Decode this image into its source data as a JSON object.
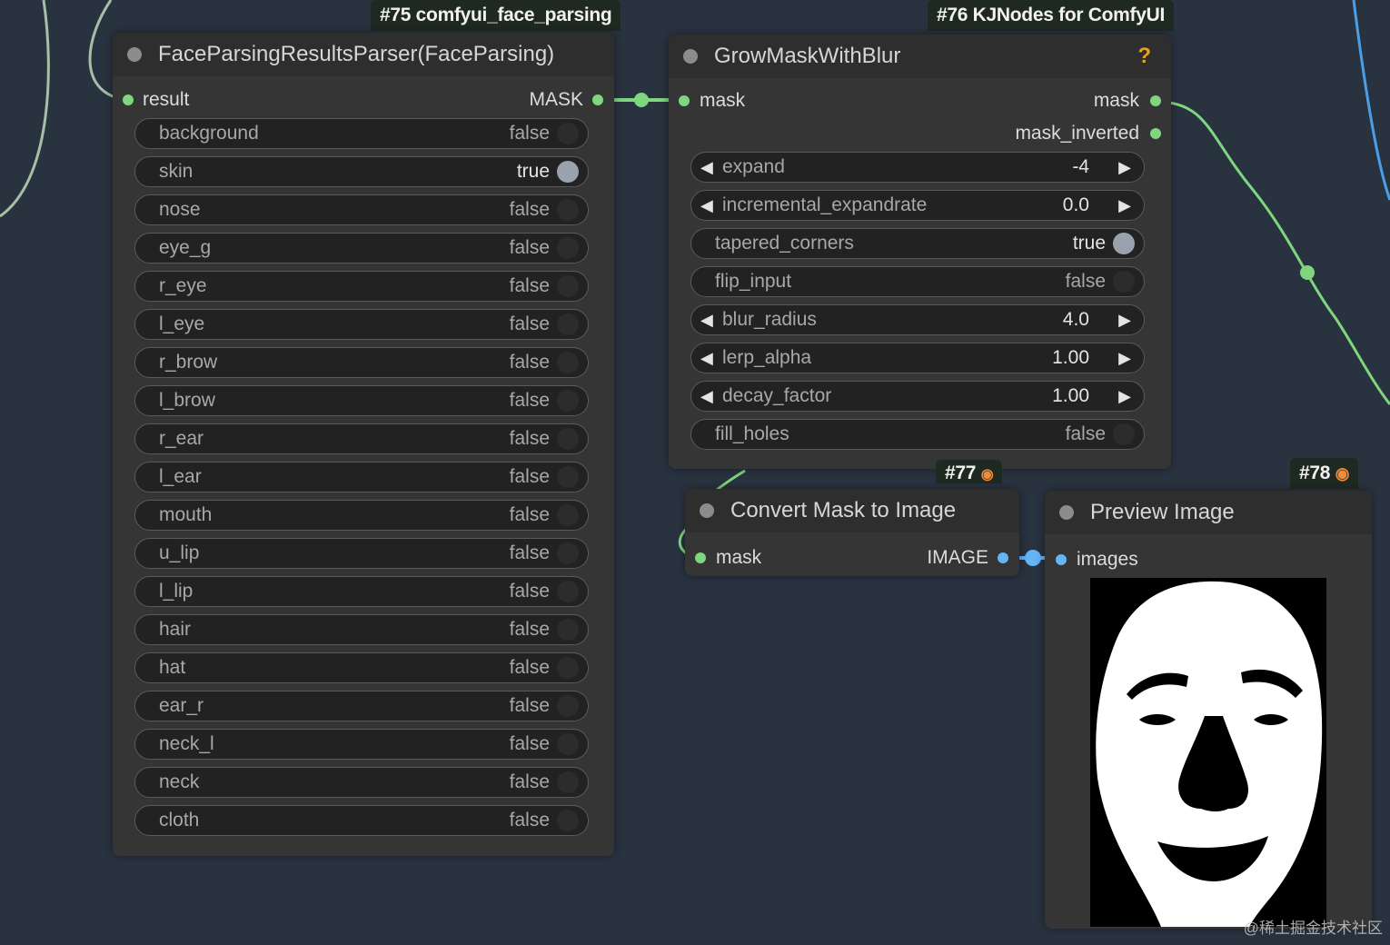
{
  "badges": {
    "n75": "#75 comfyui_face_parsing",
    "n76": "#76 KJNodes for ComfyUI",
    "n77": "#77",
    "n78": "#78"
  },
  "node75": {
    "title": "FaceParsingResultsParser(FaceParsing)",
    "input": "result",
    "output": "MASK",
    "widgets": [
      {
        "label": "background",
        "value": "false"
      },
      {
        "label": "skin",
        "value": "true"
      },
      {
        "label": "nose",
        "value": "false"
      },
      {
        "label": "eye_g",
        "value": "false"
      },
      {
        "label": "r_eye",
        "value": "false"
      },
      {
        "label": "l_eye",
        "value": "false"
      },
      {
        "label": "r_brow",
        "value": "false"
      },
      {
        "label": "l_brow",
        "value": "false"
      },
      {
        "label": "r_ear",
        "value": "false"
      },
      {
        "label": "l_ear",
        "value": "false"
      },
      {
        "label": "mouth",
        "value": "false"
      },
      {
        "label": "u_lip",
        "value": "false"
      },
      {
        "label": "l_lip",
        "value": "false"
      },
      {
        "label": "hair",
        "value": "false"
      },
      {
        "label": "hat",
        "value": "false"
      },
      {
        "label": "ear_r",
        "value": "false"
      },
      {
        "label": "neck_l",
        "value": "false"
      },
      {
        "label": "neck",
        "value": "false"
      },
      {
        "label": "cloth",
        "value": "false"
      }
    ]
  },
  "node76": {
    "title": "GrowMaskWithBlur",
    "help": "?",
    "input": "mask",
    "outputs": [
      "mask",
      "mask_inverted"
    ],
    "widgets": [
      {
        "label": "expand",
        "value": "-4",
        "kind": "number"
      },
      {
        "label": "incremental_expandrate",
        "value": "0.0",
        "kind": "number"
      },
      {
        "label": "tapered_corners",
        "value": "true",
        "kind": "toggle"
      },
      {
        "label": "flip_input",
        "value": "false",
        "kind": "toggle"
      },
      {
        "label": "blur_radius",
        "value": "4.0",
        "kind": "number"
      },
      {
        "label": "lerp_alpha",
        "value": "1.00",
        "kind": "number"
      },
      {
        "label": "decay_factor",
        "value": "1.00",
        "kind": "number"
      },
      {
        "label": "fill_holes",
        "value": "false",
        "kind": "toggle"
      }
    ]
  },
  "node77": {
    "title": "Convert Mask to Image",
    "input": "mask",
    "output": "IMAGE"
  },
  "node78": {
    "title": "Preview Image",
    "input": "images"
  },
  "watermark": "@稀土掘金技术社区",
  "colors": {
    "canvas": "#293340",
    "mask_link": "#7fd67f",
    "image_link": "#64b5f6",
    "link_gray": "#a8c2a8"
  }
}
